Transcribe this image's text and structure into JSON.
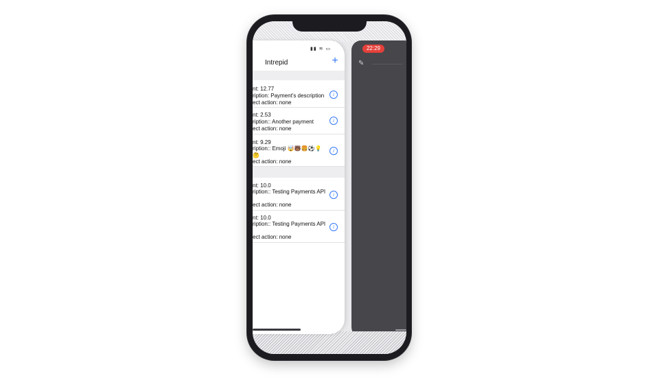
{
  "app": {
    "nav_title": "Intrepid",
    "add_label": "+",
    "status_icons": "▮▮ ≋ ▭",
    "accent_color": "#3478f6"
  },
  "other_app": {
    "time": "22:29",
    "pencil_icon": "✎"
  },
  "sections": [
    {
      "rows": [
        {
          "amount": "nt: 12.77",
          "description": "ription: Payment's description",
          "action": "ect action: none"
        },
        {
          "amount": "nt: 2.53",
          "description": "ription:: Another payment",
          "action": "ect action: none"
        },
        {
          "amount": "nt: 9.29",
          "description": "ription:: Emoji 🤯🐻🍔⚽💡",
          "description2": "🤔",
          "action": "ect action: none"
        }
      ]
    },
    {
      "rows": [
        {
          "amount": "nt: 10.0",
          "description": "ription:: Testing Payments API",
          "action": "ect action: none"
        },
        {
          "amount": "nt: 10.0",
          "description": "ription:: Testing Payments API",
          "action": "ect action: none"
        }
      ]
    }
  ],
  "info_glyph": "i"
}
